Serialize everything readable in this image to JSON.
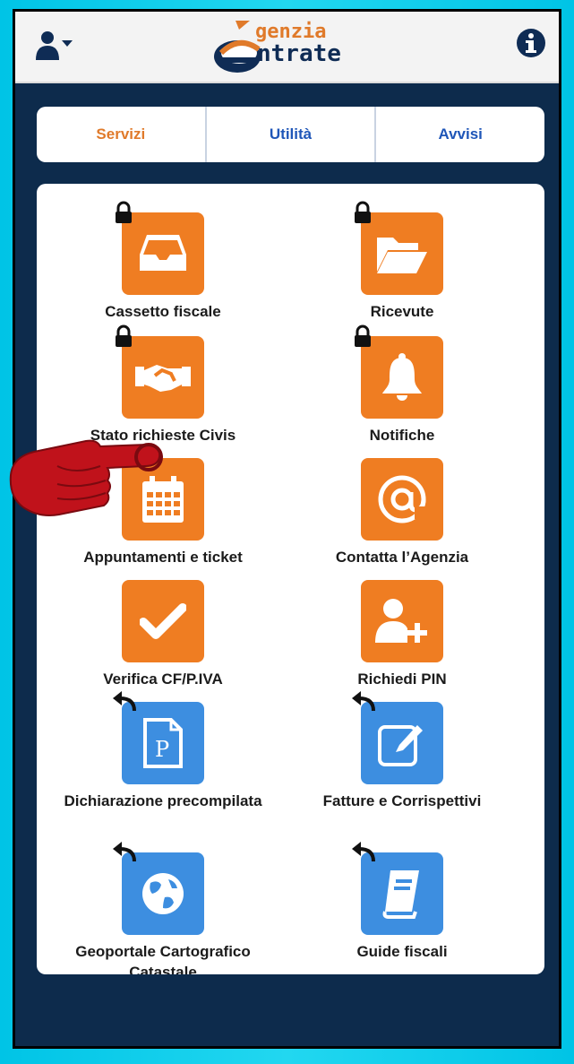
{
  "header": {
    "logo": {
      "line1": "genzia",
      "line2": "ntrate"
    },
    "icons": {
      "user": "user-icon",
      "info": "info-icon"
    }
  },
  "tabs": [
    {
      "label": "Servizi",
      "active": true
    },
    {
      "label": "Utilità",
      "active": false
    },
    {
      "label": "Avvisi",
      "active": false
    }
  ],
  "services": [
    {
      "label": "Cassetto fiscale",
      "icon": "inbox-tray-icon",
      "color": "#ef7d22",
      "badge": "lock-icon"
    },
    {
      "label": "Ricevute",
      "icon": "open-folder-icon",
      "color": "#ef7d22",
      "badge": "lock-icon"
    },
    {
      "label": "Stato richieste Civis",
      "icon": "handshake-icon",
      "color": "#ef7d22",
      "badge": "lock-icon"
    },
    {
      "label": "Notifiche",
      "icon": "bell-icon",
      "color": "#ef7d22",
      "badge": "lock-icon"
    },
    {
      "label": "Appuntamenti e ticket",
      "icon": "calendar-icon",
      "color": "#ef7d22",
      "badge": ""
    },
    {
      "label": "Contatta l’Agenzia",
      "icon": "at-sign-icon",
      "color": "#ef7d22",
      "badge": ""
    },
    {
      "label": "Verifica CF/P.IVA",
      "icon": "checkmark-icon",
      "color": "#ef7d22",
      "badge": ""
    },
    {
      "label": "Richiedi PIN",
      "icon": "add-user-icon",
      "color": "#ef7d22",
      "badge": ""
    },
    {
      "label": "Dichiarazione precompilata",
      "icon": "document-p-icon",
      "color": "#3d8ee0",
      "badge": "external-arrow-icon"
    },
    {
      "label": "Fatture e Corrispettivi",
      "icon": "edit-document-icon",
      "color": "#3d8ee0",
      "badge": "external-arrow-icon"
    },
    {
      "label": "Geoportale Cartografico Catastale",
      "icon": "globe-icon",
      "color": "#3d8ee0",
      "badge": "external-arrow-icon"
    },
    {
      "label": "Guide fiscali",
      "icon": "book-icon",
      "color": "#3d8ee0",
      "badge": "external-arrow-icon"
    }
  ],
  "overlay": {
    "icon": "pointing-hand-icon"
  },
  "colors": {
    "accent": "#ef7d22",
    "link": "#1f56b8",
    "external": "#3d8ee0",
    "background": "#0d2b4c"
  }
}
